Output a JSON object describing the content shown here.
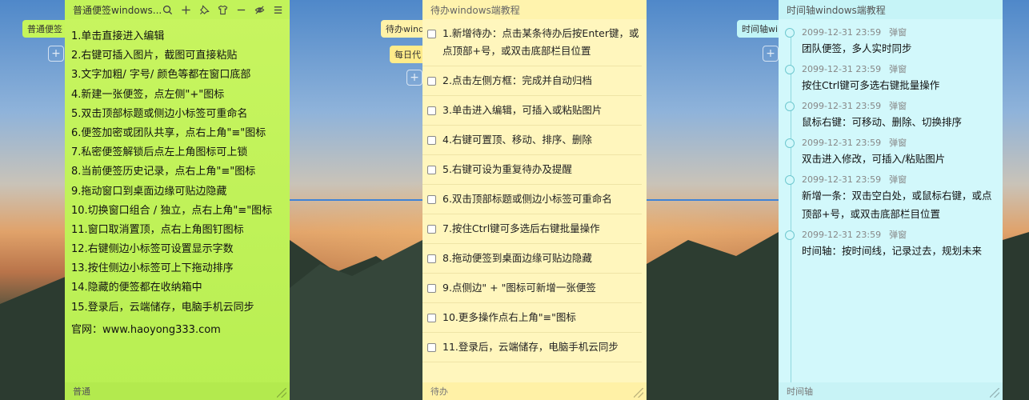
{
  "colors": {
    "normal": "#c8f560",
    "todo": "#fff6bd",
    "timeline": "#d2f8fb"
  },
  "side_tabs": {
    "normal": "普通便签",
    "todo": "待办wind",
    "todo2": "每日代",
    "time": "时间轴wind"
  },
  "normal": {
    "title": "普通便签windows...",
    "icons": [
      "search-icon",
      "plus-icon",
      "pin-icon",
      "shirt-icon",
      "minimize-icon",
      "eye-off-icon",
      "menu-icon"
    ],
    "lines": [
      "1.单击直接进入编辑",
      "2.右键可插入图片，截图可直接粘贴",
      "3.文字加粗/ 字号/ 颜色等都在窗口底部",
      "4.新建一张便签，点左侧\"+\"图标",
      "5.双击顶部标题或侧边小标签可重命名",
      "6.便签加密或团队共享，点右上角\"≡\"图标",
      "7.私密便签解锁后点左上角图标可上锁",
      "8.当前便签历史记录，点右上角\"≡\"图标",
      "9.拖动窗口到桌面边缘可贴边隐藏",
      "10.切换窗口组合 / 独立，点右上角\"≡\"图标",
      "11.窗口取消置顶，点右上角图钉图标",
      "12.右键侧边小标签可设置显示字数",
      "13.按住侧边小标签可上下拖动排序",
      "14.隐藏的便签都在收纳箱中",
      "15.登录后，云端储存，电脑手机云同步"
    ],
    "url": "官网：www.haoyong333.com",
    "footer": "普通"
  },
  "todo": {
    "title": "待办windows端教程",
    "items": [
      "1.新增待办：点击某条待办后按Enter键，或点顶部+号，或双击底部栏目位置",
      "2.点击左侧方框：完成并自动归档",
      "3.单击进入编辑，可插入或粘贴图片",
      "4.右键可置顶、移动、排序、删除",
      "5.右键可设为重复待办及提醒",
      "6.双击顶部标题或侧边小标签可重命名",
      "7.按住Ctrl键可多选后右键批量操作",
      "8.拖动便签到桌面边缘可贴边隐藏",
      "9.点侧边\" + \"图标可新增一张便签",
      "10.更多操作点右上角\"≡\"图标",
      "11.登录后，云端储存，电脑手机云同步"
    ],
    "footer": "待办"
  },
  "timeline": {
    "title": "时间轴windows端教程",
    "entries": [
      {
        "time": "2099-12-31 23:59",
        "tag": "弹窗",
        "text": "团队便签，多人实时同步"
      },
      {
        "time": "2099-12-31 23:59",
        "tag": "弹窗",
        "text": "按住Ctrl键可多选右键批量操作"
      },
      {
        "time": "2099-12-31 23:59",
        "tag": "弹窗",
        "text": "鼠标右键：可移动、删除、切换排序"
      },
      {
        "time": "2099-12-31 23:59",
        "tag": "弹窗",
        "text": "双击进入修改，可插入/粘贴图片"
      },
      {
        "time": "2099-12-31 23:59",
        "tag": "弹窗",
        "text": "新增一条：双击空白处，或鼠标右键，或点顶部+号，或双击底部栏目位置"
      },
      {
        "time": "2099-12-31 23:59",
        "tag": "弹窗",
        "text": "时间轴：按时间线，记录过去，规划未来"
      }
    ],
    "footer": "时间轴"
  }
}
